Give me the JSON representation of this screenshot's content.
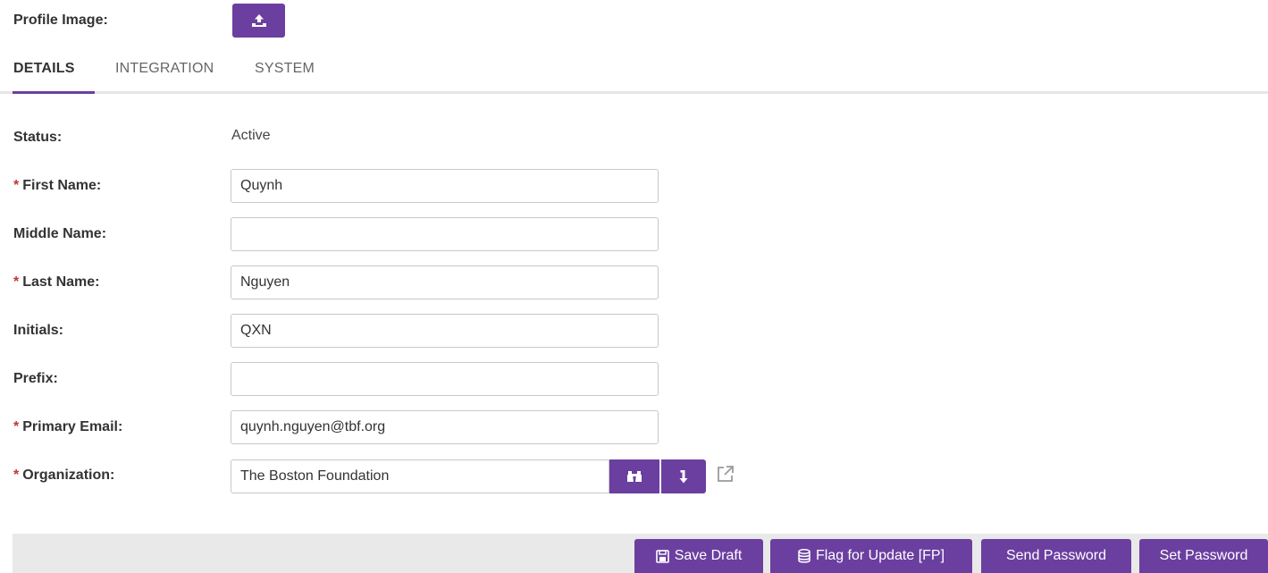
{
  "profile": {
    "label": "Profile Image:"
  },
  "tabs": [
    {
      "label": "DETAILS",
      "active": true
    },
    {
      "label": "INTEGRATION",
      "active": false
    },
    {
      "label": "SYSTEM",
      "active": false
    }
  ],
  "form": {
    "status": {
      "label": "Status:",
      "value": "Active"
    },
    "first_name": {
      "required": "*",
      "label": "First Name:",
      "value": "Quynh"
    },
    "middle_name": {
      "label": "Middle Name:",
      "value": ""
    },
    "last_name": {
      "required": "*",
      "label": "Last Name:",
      "value": "Nguyen"
    },
    "initials": {
      "label": "Initials:",
      "value": "QXN"
    },
    "prefix": {
      "label": "Prefix:",
      "value": ""
    },
    "primary_email": {
      "required": "*",
      "label": "Primary Email:",
      "value": "quynh.nguyen@tbf.org"
    },
    "organization": {
      "required": "*",
      "label": "Organization:",
      "value": "The Boston Foundation"
    }
  },
  "footer": {
    "save_draft": "Save Draft",
    "flag_update": "Flag for Update [FP]",
    "send_password": "Send Password",
    "set_password": "Set Password"
  },
  "icons": {
    "upload": "upload-icon",
    "find": "binoculars-icon",
    "down": "arrow-down-icon",
    "external": "external-link-icon",
    "save": "save-icon",
    "database": "database-icon"
  },
  "colors": {
    "accent": "#6b3fa0",
    "required": "#c0392b",
    "footer_bg": "#e9e9e9"
  }
}
